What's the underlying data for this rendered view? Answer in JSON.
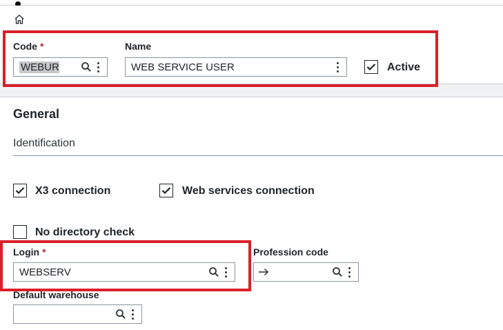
{
  "header": {
    "code": {
      "label": "Code",
      "required_mark": "*",
      "value": "WEBUR"
    },
    "name": {
      "label": "Name",
      "value": "WEB SERVICE USER"
    },
    "active": {
      "label": "Active",
      "checked": true
    }
  },
  "general": {
    "title": "General",
    "identification": {
      "title": "Identification"
    },
    "x3_connection": {
      "label": "X3 connection",
      "checked": true
    },
    "web_services_connection": {
      "label": "Web services connection",
      "checked": true
    },
    "no_directory_check": {
      "label": "No directory check",
      "checked": false
    },
    "login": {
      "label": "Login",
      "required_mark": "*",
      "value": "WEBSERV"
    },
    "profession_code": {
      "label": "Profession code",
      "value": ""
    },
    "default_warehouse": {
      "label": "Default warehouse",
      "value": ""
    }
  },
  "icons": {
    "home": "home-icon",
    "lookup": "search-icon",
    "more": "more-vertical-icon",
    "check": "check-icon",
    "arrow": "arrow-right-icon"
  },
  "colors": {
    "highlight": "#d9202a",
    "required": "#b0283d",
    "background": "#f1f2f3"
  }
}
